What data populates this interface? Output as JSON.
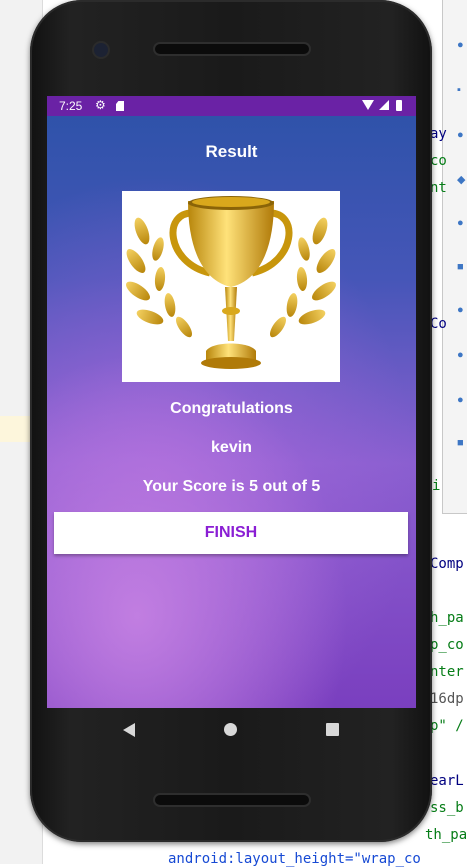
{
  "status_bar": {
    "time": "7:25"
  },
  "screen": {
    "title": "Result",
    "congratulations": "Congratulations",
    "name": "kevin",
    "score_text": "Your Score is 5 out of 5",
    "finish_label": "FINISH"
  },
  "ide_code_fragments": [
    "ay",
    "co",
    "nt",
    "Co",
    "i",
    "Comp",
    "h_pa",
    "p_co",
    "nter",
    "16dp",
    "p\" /",
    "earL",
    "ss_b",
    "th_pa",
    "android:layout_height=\"wrap_co"
  ],
  "colors": {
    "status_bar": "#6a22a5",
    "finish_text": "#8a1ed4",
    "gradient_top": "#2c52a8",
    "gradient_bottom": "#7a3fbf"
  },
  "icons": [
    "settings-icon",
    "sd-card-icon",
    "wifi-icon",
    "signal-icon",
    "battery-icon",
    "trophy-image",
    "back-icon",
    "home-icon",
    "recents-icon"
  ]
}
